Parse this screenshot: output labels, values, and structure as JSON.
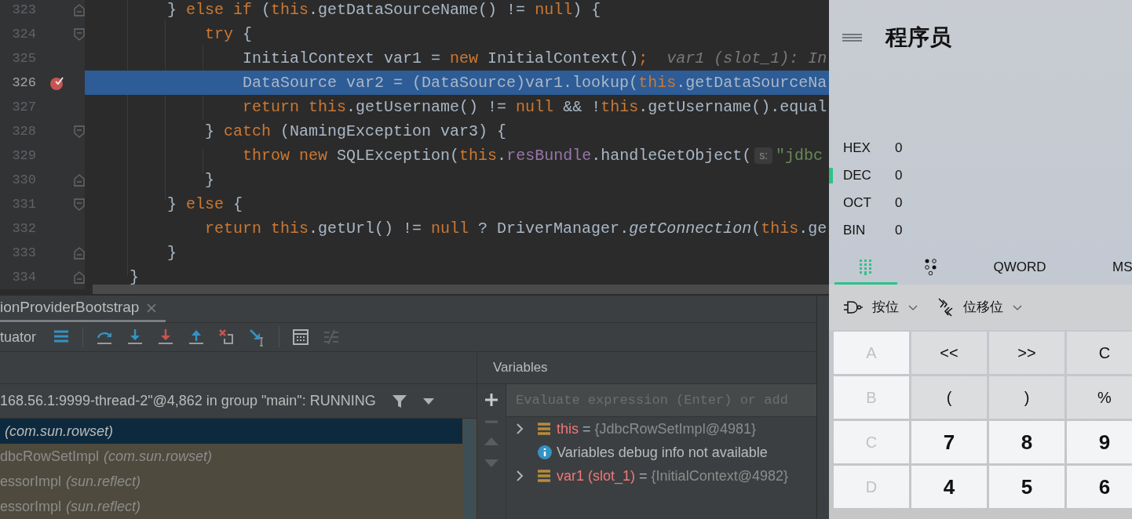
{
  "editor": {
    "lines": [
      {
        "number": "323",
        "kind": "closer",
        "breakpoint": false,
        "current": false,
        "tokens": [
          {
            "kind": "plain",
            "text": "        } "
          },
          {
            "kind": "keyword",
            "text": "else if"
          },
          {
            "kind": "plain",
            "text": " ("
          },
          {
            "kind": "keyword",
            "text": "this"
          },
          {
            "kind": "plain",
            "text": ".getDataSourceName() != "
          },
          {
            "kind": "keyword",
            "text": "null"
          },
          {
            "kind": "plain",
            "text": ") {"
          }
        ]
      },
      {
        "number": "324",
        "kind": "opener",
        "breakpoint": false,
        "current": false,
        "tokens": [
          {
            "kind": "keyword",
            "text": "            try"
          },
          {
            "kind": "plain",
            "text": " {"
          }
        ]
      },
      {
        "number": "325",
        "kind": "plain",
        "breakpoint": false,
        "current": false,
        "tokens": [
          {
            "kind": "plain",
            "text": "                InitialContext var1 = "
          },
          {
            "kind": "keyword",
            "text": "new"
          },
          {
            "kind": "plain",
            "text": " InitialContext()"
          },
          {
            "kind": "keyword",
            "text": ";"
          },
          {
            "kind": "hint",
            "text": "var1 (slot_1): In"
          }
        ]
      },
      {
        "number": "326",
        "kind": "plain",
        "breakpoint": true,
        "current": true,
        "tokens": [
          {
            "kind": "plain",
            "text": "                DataSource var2 = (DataSource)var1.lookup("
          },
          {
            "kind": "keyword",
            "text": "this"
          },
          {
            "kind": "plain",
            "text": ".getDataSourceNa"
          }
        ]
      },
      {
        "number": "327",
        "kind": "plain",
        "breakpoint": false,
        "current": false,
        "tokens": [
          {
            "kind": "keyword",
            "text": "                return this"
          },
          {
            "kind": "plain",
            "text": ".getUsername() != "
          },
          {
            "kind": "keyword",
            "text": "null"
          },
          {
            "kind": "plain",
            "text": " && !"
          },
          {
            "kind": "keyword",
            "text": "this"
          },
          {
            "kind": "plain",
            "text": ".getUsername().equal"
          }
        ]
      },
      {
        "number": "328",
        "kind": "opener",
        "breakpoint": false,
        "current": false,
        "tokens": [
          {
            "kind": "plain",
            "text": "            } "
          },
          {
            "kind": "keyword",
            "text": "catch"
          },
          {
            "kind": "plain",
            "text": " (NamingException var3) {"
          }
        ]
      },
      {
        "number": "329",
        "kind": "plain",
        "breakpoint": false,
        "current": false,
        "tokens": [
          {
            "kind": "keyword",
            "text": "                throw new"
          },
          {
            "kind": "plain",
            "text": " SQLException("
          },
          {
            "kind": "keyword",
            "text": "this"
          },
          {
            "kind": "plain",
            "text": "."
          },
          {
            "kind": "field",
            "text": "resBundle"
          },
          {
            "kind": "plain",
            "text": ".handleGetObject("
          },
          {
            "kind": "chip",
            "text": "s:"
          },
          {
            "kind": "string",
            "text": "\"jdbc"
          }
        ]
      },
      {
        "number": "330",
        "kind": "closer",
        "breakpoint": false,
        "current": false,
        "tokens": [
          {
            "kind": "plain",
            "text": "            }"
          }
        ]
      },
      {
        "number": "331",
        "kind": "opener",
        "breakpoint": false,
        "current": false,
        "tokens": [
          {
            "kind": "plain",
            "text": "        } "
          },
          {
            "kind": "keyword",
            "text": "else"
          },
          {
            "kind": "plain",
            "text": " {"
          }
        ]
      },
      {
        "number": "332",
        "kind": "plain",
        "breakpoint": false,
        "current": false,
        "tokens": [
          {
            "kind": "keyword",
            "text": "            return this"
          },
          {
            "kind": "plain",
            "text": ".getUrl() != "
          },
          {
            "kind": "keyword",
            "text": "null"
          },
          {
            "kind": "plain",
            "text": " ? DriverManager."
          },
          {
            "kind": "static",
            "text": "getConnection"
          },
          {
            "kind": "plain",
            "text": "("
          },
          {
            "kind": "keyword",
            "text": "this"
          },
          {
            "kind": "plain",
            "text": ".ge"
          }
        ]
      },
      {
        "number": "333",
        "kind": "closer",
        "breakpoint": false,
        "current": false,
        "tokens": [
          {
            "kind": "plain",
            "text": "        }"
          }
        ]
      },
      {
        "number": "334",
        "kind": "closer",
        "breakpoint": false,
        "current": false,
        "tokens": [
          {
            "kind": "plain",
            "text": "    }"
          }
        ]
      }
    ]
  },
  "debug_panel": {
    "tabs": [
      {
        "label": "ionProviderBootstrap",
        "selected": true
      }
    ],
    "toolbar_label": "tuator",
    "thread": "168.56.1:9999-thread-2\"@4,862 in group \"main\": RUNNING",
    "frames": [
      {
        "package": "(com.sun.rowset)",
        "selected": true
      },
      {
        "name": "dbcRowSetImpl",
        "package": "(com.sun.rowset)",
        "selected": false
      },
      {
        "name": "essorImpl",
        "package": "(sun.reflect)",
        "selected": false
      },
      {
        "name": "essorImpl",
        "package": "(sun.reflect)",
        "selected": false
      }
    ],
    "variables": {
      "title": "Variables",
      "placeholder": "Evaluate expression (Enter) or add",
      "rows": [
        {
          "kind": "var",
          "name": "this",
          "separator": "=",
          "value": "{JdbcRowSetImpl@4981}"
        },
        {
          "kind": "info",
          "text": "Variables debug info not available"
        },
        {
          "kind": "var",
          "name": "var1 (slot_1)",
          "separator": "=",
          "value": "{InitialContext@4982}"
        }
      ]
    }
  },
  "calculator": {
    "mode": "程序员",
    "radix": [
      {
        "label": "HEX",
        "value": "0",
        "selected": false
      },
      {
        "label": "DEC",
        "value": "0",
        "selected": true
      },
      {
        "label": "OCT",
        "value": "0",
        "selected": false
      },
      {
        "label": "BIN",
        "value": "0",
        "selected": false
      }
    ],
    "tabs": [
      {
        "kind": "keypad",
        "selected": true
      },
      {
        "kind": "bits",
        "selected": false
      },
      {
        "kind": "text",
        "label": "QWORD",
        "selected": false
      },
      {
        "kind": "text",
        "label": "MS",
        "selected": false
      }
    ],
    "menus": [
      {
        "kind": "bitwise",
        "label": "按位"
      },
      {
        "kind": "shift",
        "label": "位移位"
      }
    ],
    "keys": [
      {
        "label": "A",
        "kind": "letter",
        "disabled": true
      },
      {
        "label": "<<",
        "kind": "operator",
        "disabled": false
      },
      {
        "label": ">>",
        "kind": "operator",
        "disabled": false
      },
      {
        "label": "C",
        "kind": "operator",
        "disabled": false
      },
      {
        "label": "B",
        "kind": "letter",
        "disabled": true
      },
      {
        "label": "(",
        "kind": "operator",
        "disabled": false
      },
      {
        "label": ")",
        "kind": "operator",
        "disabled": false
      },
      {
        "label": "%",
        "kind": "operator",
        "disabled": false
      },
      {
        "label": "C",
        "kind": "letter",
        "disabled": true
      },
      {
        "label": "7",
        "kind": "digit",
        "disabled": false
      },
      {
        "label": "8",
        "kind": "digit",
        "disabled": false
      },
      {
        "label": "9",
        "kind": "digit",
        "disabled": false
      },
      {
        "label": "D",
        "kind": "letter",
        "disabled": true
      },
      {
        "label": "4",
        "kind": "digit",
        "disabled": false
      },
      {
        "label": "5",
        "kind": "digit",
        "disabled": false
      },
      {
        "label": "6",
        "kind": "digit",
        "disabled": false
      }
    ]
  }
}
